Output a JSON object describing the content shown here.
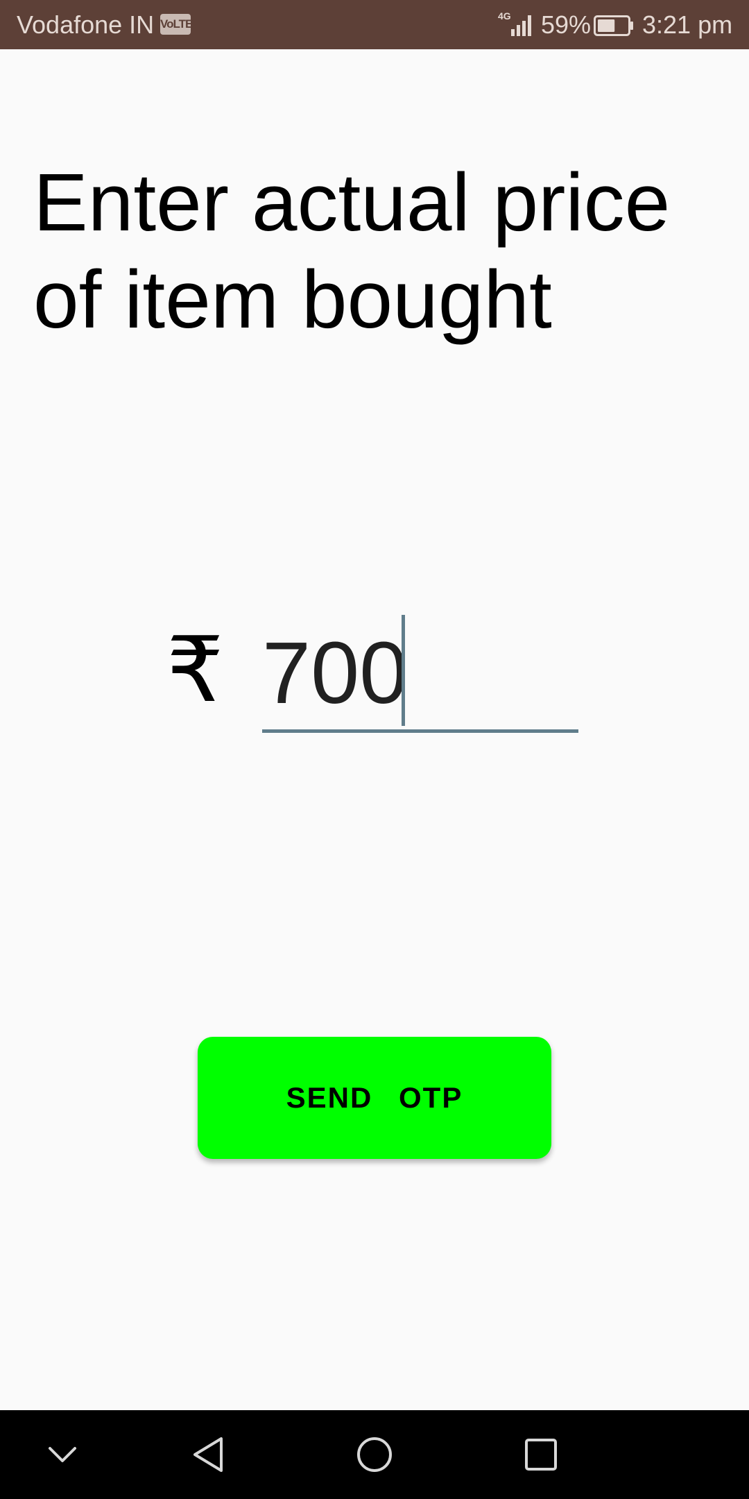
{
  "status_bar": {
    "carrier": "Vodafone IN",
    "volte_badge": "VoLTE",
    "network_type": "4G",
    "battery_percent": "59%",
    "battery_level": 0.59,
    "time": "3:21 pm",
    "icons": [
      "signal-icon",
      "battery-icon"
    ]
  },
  "main": {
    "heading": "Enter actual price of item bought",
    "currency_symbol": "₹",
    "price_value": "700",
    "send_button_label": "SEND OTP",
    "send_button_color": "#00ff00",
    "input_underline_color": "#607d8b"
  },
  "nav_bar": {
    "icons": [
      "chevron-down-icon",
      "back-icon",
      "home-icon",
      "recents-icon"
    ]
  },
  "colors": {
    "status_bar": "#5d4037",
    "background": "#fafafa",
    "nav_bar": "#000000"
  }
}
